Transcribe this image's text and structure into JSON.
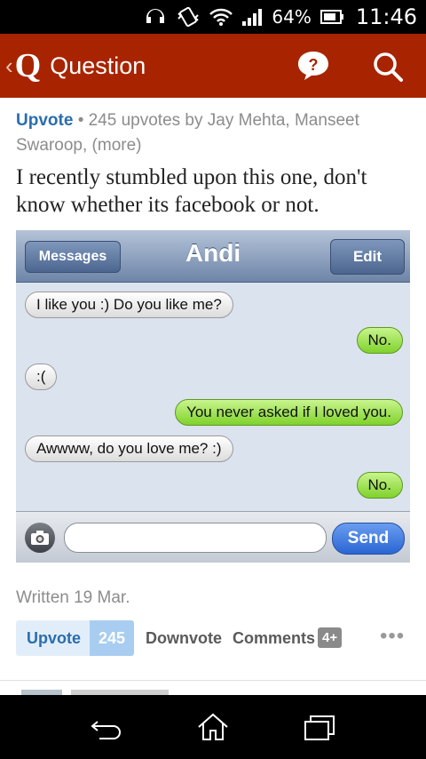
{
  "status_bar": {
    "battery_percent": "64%",
    "time": "11:46",
    "icons": [
      "headset-icon",
      "vibrate-icon",
      "wifi-icon",
      "signal-icon",
      "battery-icon"
    ]
  },
  "header": {
    "back_glyph": "‹",
    "logo": "Q",
    "title": "Question",
    "help_icon": "help-bubble-icon",
    "search_icon": "search-icon",
    "color": "#a82400"
  },
  "answer": {
    "upvote_label": "Upvote",
    "upvote_meta": "• 245 upvotes by Jay Mehta, Manseet Swaroop, (more)",
    "text": "I recently stumbled upon this one, don't know whether its facebook or not.",
    "screenshot": {
      "back_label": "Messages",
      "contact": "Andi",
      "edit_label": "Edit",
      "messages": [
        {
          "side": "in",
          "text": "I like you :)  Do you like me?"
        },
        {
          "side": "out",
          "text": "No."
        },
        {
          "side": "in",
          "text": ":("
        },
        {
          "side": "out",
          "text": "You never asked if I loved you."
        },
        {
          "side": "in",
          "text": "Awwww, do you love me? :)"
        },
        {
          "side": "out",
          "text": "No."
        }
      ],
      "send_label": "Send",
      "camera_icon": "camera-icon"
    },
    "written": "Written 19 Mar.",
    "actions": {
      "upvote_label": "Upvote",
      "upvote_count": "245",
      "downvote_label": "Downvote",
      "comments_label": "Comments",
      "comments_count": "4+",
      "more_glyph": "•••"
    }
  },
  "system_nav": {
    "back_icon": "back-icon",
    "home_icon": "home-icon",
    "recents_icon": "recent-apps-icon"
  }
}
